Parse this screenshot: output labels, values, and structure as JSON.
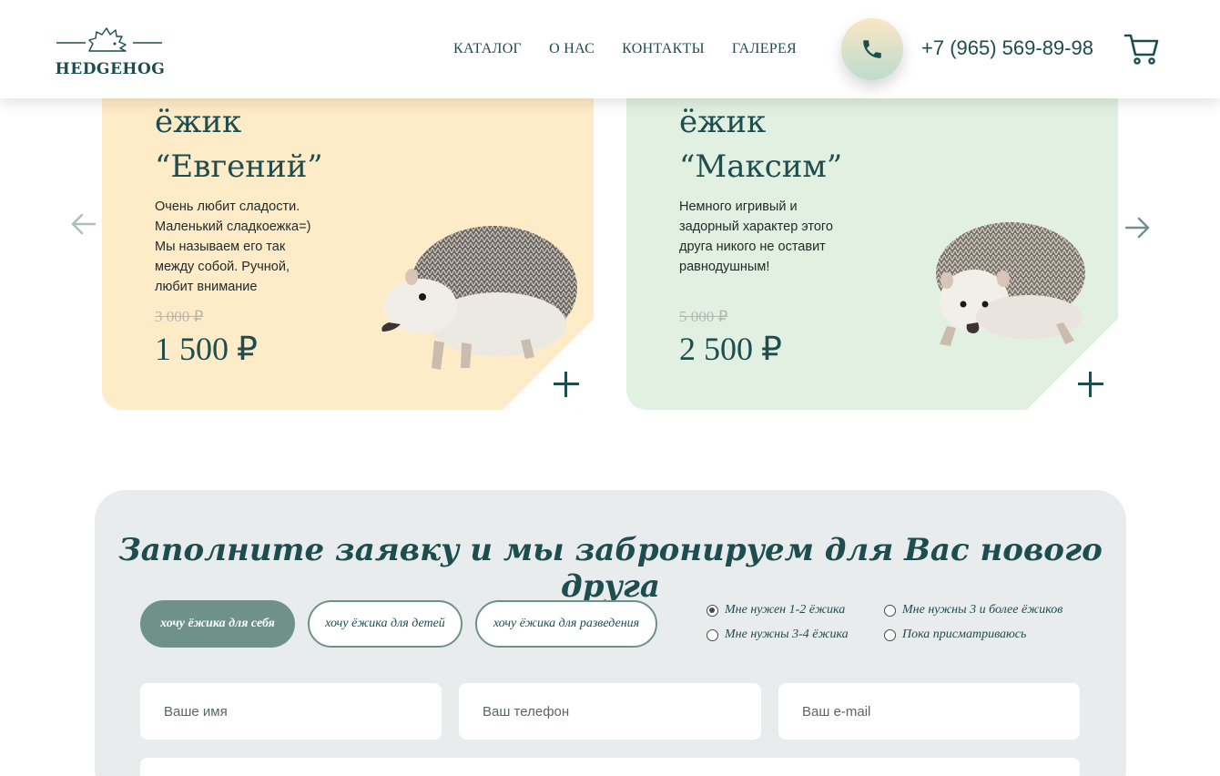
{
  "header": {
    "logo_text": "HEDGEHOG",
    "nav": [
      "КАТАЛОГ",
      "О НАС",
      "КОНТАКТЫ",
      "ГАЛЕРЕЯ"
    ],
    "phone": "+7 (965) 569-89-98"
  },
  "cards": [
    {
      "name_line1": "ёжик",
      "name_line2": "“Евгений”",
      "description": "Очень любит сладости. Маленький сладкоежка=) Мы называем его так между собой. Ручной, любит внимание",
      "old_price": "3 000 ₽",
      "price": "1 500 ₽",
      "background": "#feebc8"
    },
    {
      "name_line1": "ёжик",
      "name_line2": "“Максим”",
      "description": "Немного игривый и задорный характер этого друга никого не оставит равнодушным!",
      "old_price": "5 000 ₽",
      "price": "2 500 ₽",
      "background": "#e2f0e1"
    }
  ],
  "form": {
    "title": "Заполните заявку и мы забронируем для Вас нового друга",
    "tabs": [
      "хочу ёжика для себя",
      "хочу ёжика для детей",
      "хочу ёжика для разведения"
    ],
    "active_tab": "хочу ёжика для себя",
    "radio_options": [
      "Мне нужен 1-2 ёжика",
      "Мне нужны 3-4 ёжика",
      "Мне нужны 3 и более ёжиков",
      "Пока присматриваюсь"
    ],
    "selected_radio": "Мне нужен 1-2 ёжика",
    "placeholders": {
      "name": "Ваше имя",
      "phone": "Ваш телефон",
      "email": "Ваш e-mail"
    }
  },
  "icons": [
    "hedgehog-logo-icon",
    "phone-icon",
    "cart-icon",
    "arrow-left-icon",
    "arrow-right-icon",
    "plus-icon"
  ],
  "colors": {
    "primary": "#1d4d4f",
    "accent": "#6e9289",
    "card_yellow": "#feebc8",
    "card_green": "#e2f0e1",
    "form_bg": "#e8ecec"
  }
}
